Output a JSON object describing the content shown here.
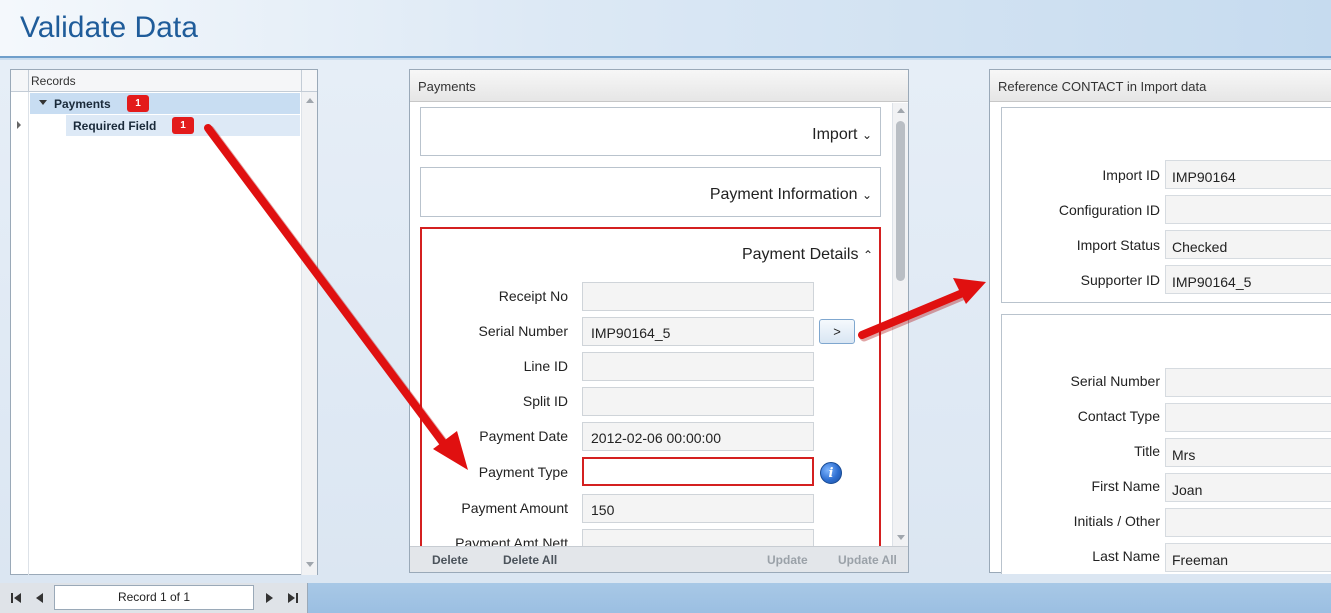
{
  "app": {
    "title": "Validate Data"
  },
  "records": {
    "header": "Records",
    "tree": [
      {
        "label": "Payments",
        "count": "1"
      },
      {
        "label": "Required Field",
        "count": "1"
      }
    ]
  },
  "payments": {
    "title": "Payments",
    "sections": {
      "import": "Import",
      "payment_information": "Payment Information",
      "payment_details": "Payment Details"
    },
    "fields": {
      "receipt_no": {
        "label": "Receipt No",
        "value": ""
      },
      "serial_number": {
        "label": "Serial Number",
        "value": "IMP90164_5"
      },
      "line_id": {
        "label": "Line ID",
        "value": ""
      },
      "split_id": {
        "label": "Split ID",
        "value": ""
      },
      "payment_date": {
        "label": "Payment Date",
        "value": "2012-02-06 00:00:00"
      },
      "payment_type": {
        "label": "Payment Type",
        "value": ""
      },
      "payment_amount": {
        "label": "Payment Amount",
        "value": "150"
      },
      "payment_amt_nett": {
        "label": "Payment Amt Nett",
        "value": ""
      }
    },
    "nav_button_label": ">",
    "info_icon_glyph": "i",
    "footer": {
      "delete": "Delete",
      "delete_all": "Delete All",
      "update": "Update",
      "update_all": "Update All"
    }
  },
  "reference": {
    "title": "Reference CONTACT in Import data",
    "group1": {
      "import_id": {
        "label": "Import ID",
        "value": "IMP90164"
      },
      "configuration_id": {
        "label": "Configuration ID",
        "value": ""
      },
      "import_status": {
        "label": "Import Status",
        "value": "Checked"
      },
      "supporter_id": {
        "label": "Supporter ID",
        "value": "IMP90164_5"
      }
    },
    "group2": {
      "serial_number": {
        "label": "Serial Number",
        "value": ""
      },
      "contact_type": {
        "label": "Contact Type",
        "value": ""
      },
      "title": {
        "label": "Title",
        "value": "Mrs"
      },
      "first_name": {
        "label": "First Name",
        "value": "Joan"
      },
      "initials_other": {
        "label": "Initials / Other",
        "value": ""
      },
      "last_name": {
        "label": "Last Name",
        "value": "Freeman"
      }
    }
  },
  "navigator": {
    "record_text": "Record 1 of 1"
  },
  "colors": {
    "accent": "#1f5c9a",
    "error": "#d42020",
    "badge": "#e31b1b",
    "annotation_arrow": "#e01010"
  }
}
